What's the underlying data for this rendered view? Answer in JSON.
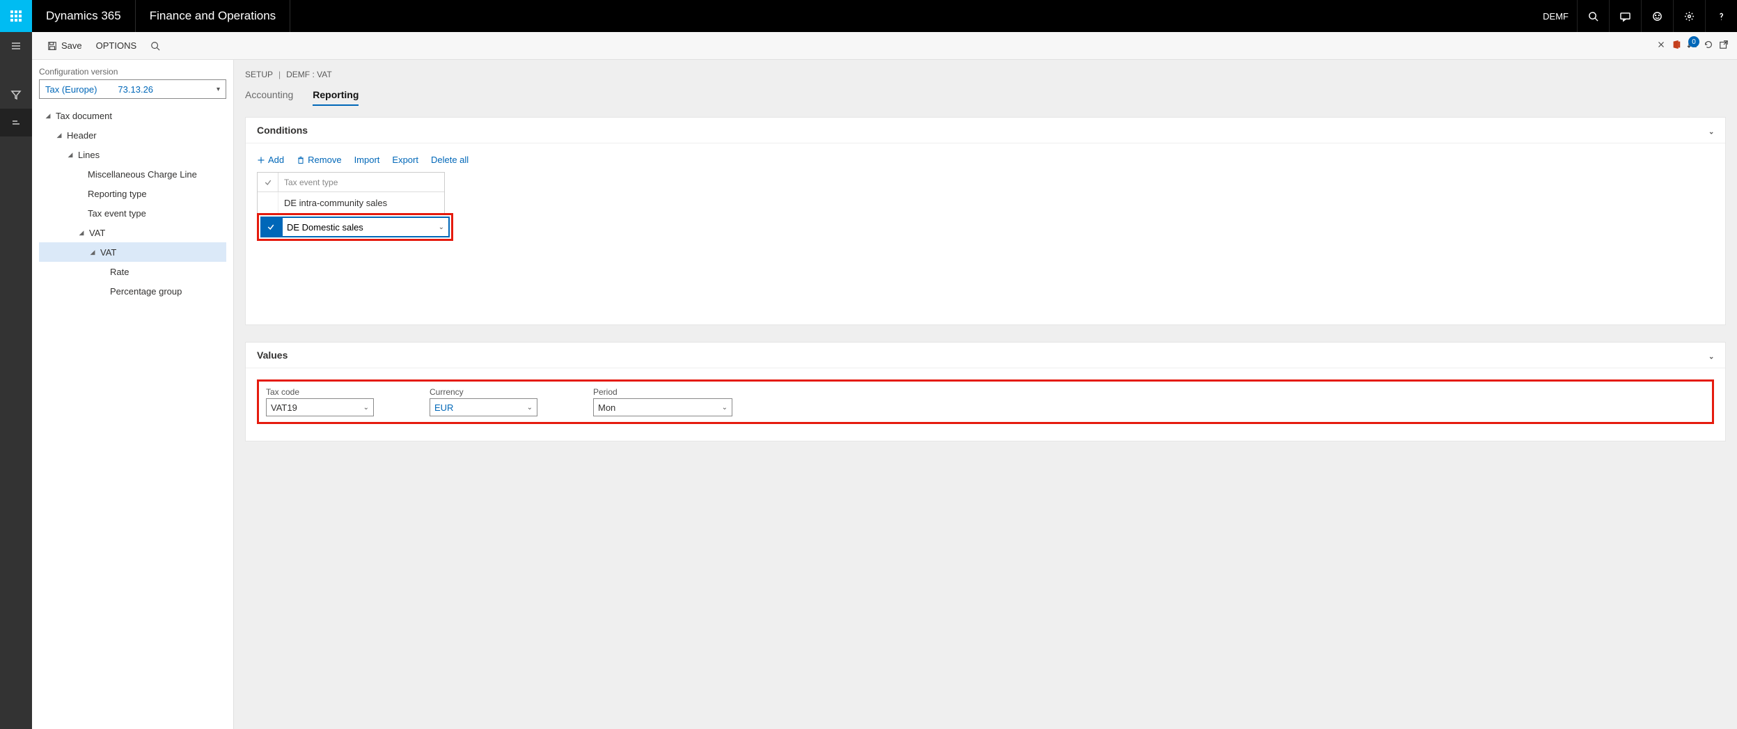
{
  "topbar": {
    "product": "Dynamics 365",
    "app": "Finance and Operations",
    "company": "DEMF"
  },
  "cmdbar": {
    "save": "Save",
    "options": "OPTIONS",
    "notif_count": "0"
  },
  "leftpane": {
    "cfg_label": "Configuration version",
    "cfg_name": "Tax (Europe)",
    "cfg_version": "73.13.26",
    "tree": {
      "n0": "Tax document",
      "n1": "Header",
      "n2": "Lines",
      "n3": "Miscellaneous Charge Line",
      "n4": "Reporting type",
      "n5": "Tax event type",
      "n6": "VAT",
      "n7": "VAT",
      "n8": "Rate",
      "n9": "Percentage group"
    }
  },
  "breadcrumb": {
    "a": "SETUP",
    "b": "DEMF : VAT"
  },
  "tabs": {
    "accounting": "Accounting",
    "reporting": "Reporting"
  },
  "conditions": {
    "title": "Conditions",
    "btn_add": "Add",
    "btn_remove": "Remove",
    "btn_import": "Import",
    "btn_export": "Export",
    "btn_delete_all": "Delete all",
    "col_header": "Tax event type",
    "rows": {
      "r0": "DE intra-community sales",
      "r1": "DE Domestic sales"
    }
  },
  "values": {
    "title": "Values",
    "tax_code_label": "Tax code",
    "tax_code_value": "VAT19",
    "currency_label": "Currency",
    "currency_value": "EUR",
    "period_label": "Period",
    "period_value": "Mon"
  }
}
